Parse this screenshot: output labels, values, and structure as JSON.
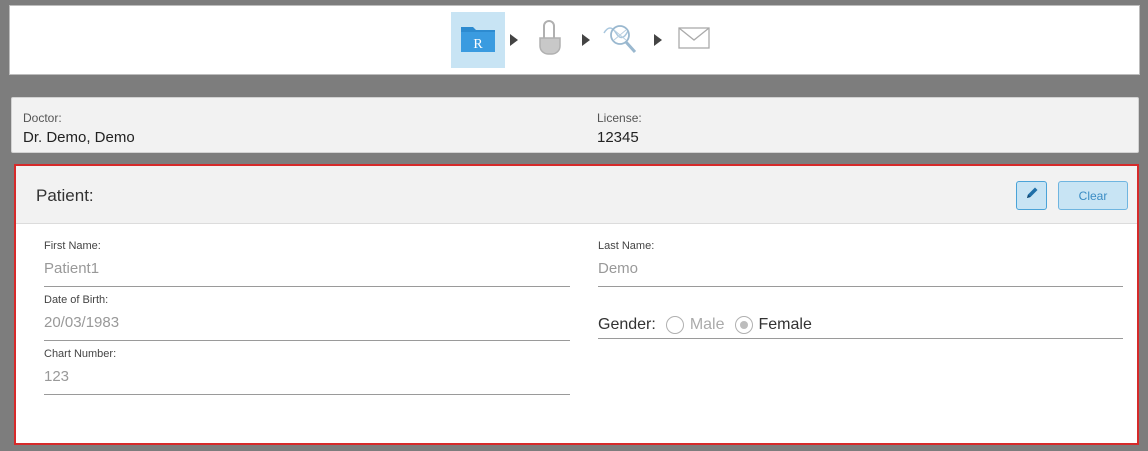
{
  "workflow": {
    "steps": [
      {
        "name": "rx",
        "icon": "rx-folder-icon",
        "letter": "R",
        "active": true
      },
      {
        "name": "scan",
        "icon": "scan-finger-icon",
        "active": false
      },
      {
        "name": "view",
        "icon": "view-magnifier-icon",
        "active": false
      },
      {
        "name": "send",
        "icon": "envelope-icon",
        "active": false
      }
    ]
  },
  "doctor": {
    "doctor_label": "Doctor:",
    "doctor_value": "Dr. Demo, Demo",
    "license_label": "License:",
    "license_value": "12345"
  },
  "patient": {
    "title": "Patient:",
    "clear_label": "Clear",
    "first_name_label": "First Name:",
    "first_name_value": "Patient1",
    "last_name_label": "Last Name:",
    "last_name_value": "Demo",
    "dob_label": "Date of Birth:",
    "dob_value": "20/03/1983",
    "chart_label": "Chart Number:",
    "chart_value": "123",
    "gender_label": "Gender:",
    "gender_options": [
      "Male",
      "Female"
    ],
    "gender_selected": "Female"
  },
  "colors": {
    "accent": "#c8e4f4",
    "highlight_border": "#d62a2a",
    "background": "#7d7d7d"
  }
}
